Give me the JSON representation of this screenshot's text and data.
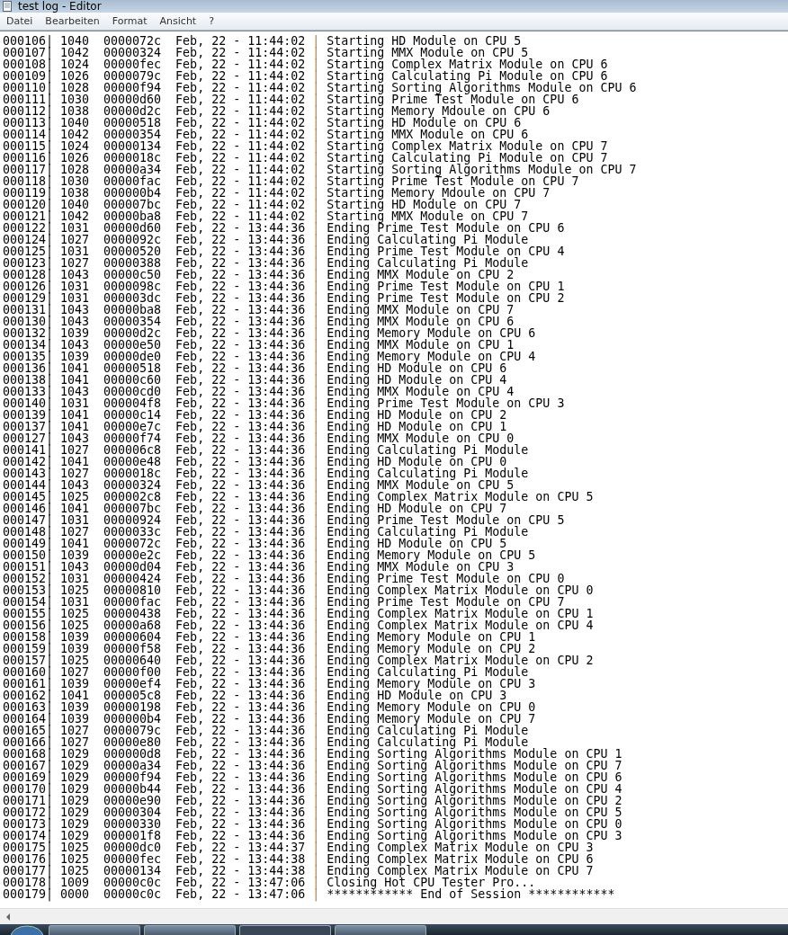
{
  "window": {
    "title": "test log - Editor"
  },
  "menu": [
    "Datei",
    "Bearbeiten",
    "Format",
    "Ansicht",
    "?"
  ],
  "rows": [
    {
      "no": "000106|",
      "tid": "1040",
      "addr": "0000072c",
      "time": "Feb, 22 - 11:44:02",
      "sep": "|",
      "msg": "Starting HD Module on CPU 5"
    },
    {
      "no": "000107|",
      "tid": "1042",
      "addr": "00000324",
      "time": "Feb, 22 - 11:44:02",
      "sep": "|",
      "msg": "Starting MMX Module on CPU 5"
    },
    {
      "no": "000108|",
      "tid": "1024",
      "addr": "00000fec",
      "time": "Feb, 22 - 11:44:02",
      "sep": "|",
      "msg": "Starting Complex Matrix Module on CPU 6"
    },
    {
      "no": "000109|",
      "tid": "1026",
      "addr": "0000079c",
      "time": "Feb, 22 - 11:44:02",
      "sep": "|",
      "msg": "Starting Calculating Pi Module on CPU 6"
    },
    {
      "no": "000110|",
      "tid": "1028",
      "addr": "00000f94",
      "time": "Feb, 22 - 11:44:02",
      "sep": "|",
      "msg": "Starting Sorting Algorithms Module on CPU 6"
    },
    {
      "no": "000111|",
      "tid": "1030",
      "addr": "00000d60",
      "time": "Feb, 22 - 11:44:02",
      "sep": "|",
      "msg": "Starting Prime Test Module on CPU 6"
    },
    {
      "no": "000112|",
      "tid": "1038",
      "addr": "00000d2c",
      "time": "Feb, 22 - 11:44:02",
      "sep": "|",
      "msg": "Starting Memory Mdoule on CPU 6"
    },
    {
      "no": "000113|",
      "tid": "1040",
      "addr": "00000518",
      "time": "Feb, 22 - 11:44:02",
      "sep": "|",
      "msg": "Starting HD Module on CPU 6"
    },
    {
      "no": "000114|",
      "tid": "1042",
      "addr": "00000354",
      "time": "Feb, 22 - 11:44:02",
      "sep": "|",
      "msg": "Starting MMX Module on CPU 6"
    },
    {
      "no": "000115|",
      "tid": "1024",
      "addr": "00000134",
      "time": "Feb, 22 - 11:44:02",
      "sep": "|",
      "msg": "Starting Complex Matrix Module on CPU 7"
    },
    {
      "no": "000116|",
      "tid": "1026",
      "addr": "0000018c",
      "time": "Feb, 22 - 11:44:02",
      "sep": "|",
      "msg": "Starting Calculating Pi Module on CPU 7"
    },
    {
      "no": "000117|",
      "tid": "1028",
      "addr": "00000a34",
      "time": "Feb, 22 - 11:44:02",
      "sep": "|",
      "msg": "Starting Sorting Algorithms Module on CPU 7"
    },
    {
      "no": "000118|",
      "tid": "1030",
      "addr": "00000fac",
      "time": "Feb, 22 - 11:44:02",
      "sep": "|",
      "msg": "Starting Prime Test Module on CPU 7"
    },
    {
      "no": "000119|",
      "tid": "1038",
      "addr": "000000b4",
      "time": "Feb, 22 - 11:44:02",
      "sep": "|",
      "msg": "Starting Memory Mdoule on CPU 7"
    },
    {
      "no": "000120|",
      "tid": "1040",
      "addr": "000007bc",
      "time": "Feb, 22 - 11:44:02",
      "sep": "|",
      "msg": "Starting HD Module on CPU 7"
    },
    {
      "no": "000121|",
      "tid": "1042",
      "addr": "00000ba8",
      "time": "Feb, 22 - 11:44:02",
      "sep": "|",
      "msg": "Starting MMX Module on CPU 7"
    },
    {
      "no": "000122|",
      "tid": "1031",
      "addr": "00000d60",
      "time": "Feb, 22 - 13:44:36",
      "sep": "|",
      "msg": "Ending Prime Test Module on CPU 6"
    },
    {
      "no": "000124|",
      "tid": "1027",
      "addr": "0000092c",
      "time": "Feb, 22 - 13:44:36",
      "sep": "|",
      "msg": "Ending Calculating Pi Module"
    },
    {
      "no": "000125|",
      "tid": "1031",
      "addr": "00000520",
      "time": "Feb, 22 - 13:44:36",
      "sep": "|",
      "msg": "Ending Prime Test Module on CPU 4"
    },
    {
      "no": "000123|",
      "tid": "1027",
      "addr": "00000388",
      "time": "Feb, 22 - 13:44:36",
      "sep": "|",
      "msg": "Ending Calculating Pi Module"
    },
    {
      "no": "000128|",
      "tid": "1043",
      "addr": "00000c50",
      "time": "Feb, 22 - 13:44:36",
      "sep": "|",
      "msg": "Ending MMX Module on CPU 2"
    },
    {
      "no": "000126|",
      "tid": "1031",
      "addr": "0000098c",
      "time": "Feb, 22 - 13:44:36",
      "sep": "|",
      "msg": "Ending Prime Test Module on CPU 1"
    },
    {
      "no": "000129|",
      "tid": "1031",
      "addr": "000003dc",
      "time": "Feb, 22 - 13:44:36",
      "sep": "|",
      "msg": "Ending Prime Test Module on CPU 2"
    },
    {
      "no": "000131|",
      "tid": "1043",
      "addr": "00000ba8",
      "time": "Feb, 22 - 13:44:36",
      "sep": "|",
      "msg": "Ending MMX Module on CPU 7"
    },
    {
      "no": "000130|",
      "tid": "1043",
      "addr": "00000354",
      "time": "Feb, 22 - 13:44:36",
      "sep": "|",
      "msg": "Ending MMX Module on CPU 6"
    },
    {
      "no": "000132|",
      "tid": "1039",
      "addr": "00000d2c",
      "time": "Feb, 22 - 13:44:36",
      "sep": "|",
      "msg": "Ending Memory Module on CPU 6"
    },
    {
      "no": "000134|",
      "tid": "1043",
      "addr": "00000e50",
      "time": "Feb, 22 - 13:44:36",
      "sep": "|",
      "msg": "Ending MMX Module on CPU 1"
    },
    {
      "no": "000135|",
      "tid": "1039",
      "addr": "00000de0",
      "time": "Feb, 22 - 13:44:36",
      "sep": "|",
      "msg": "Ending Memory Module on CPU 4"
    },
    {
      "no": "000136|",
      "tid": "1041",
      "addr": "00000518",
      "time": "Feb, 22 - 13:44:36",
      "sep": "|",
      "msg": "Ending HD Module on CPU 6"
    },
    {
      "no": "000138|",
      "tid": "1041",
      "addr": "00000c60",
      "time": "Feb, 22 - 13:44:36",
      "sep": "|",
      "msg": "Ending HD Module on CPU 4"
    },
    {
      "no": "000133|",
      "tid": "1043",
      "addr": "00000cd0",
      "time": "Feb, 22 - 13:44:36",
      "sep": "|",
      "msg": "Ending MMX Module on CPU 4"
    },
    {
      "no": "000140|",
      "tid": "1031",
      "addr": "000004f8",
      "time": "Feb, 22 - 13:44:36",
      "sep": "|",
      "msg": "Ending Prime Test Module on CPU 3"
    },
    {
      "no": "000139|",
      "tid": "1041",
      "addr": "00000c14",
      "time": "Feb, 22 - 13:44:36",
      "sep": "|",
      "msg": "Ending HD Module on CPU 2"
    },
    {
      "no": "000137|",
      "tid": "1041",
      "addr": "00000e7c",
      "time": "Feb, 22 - 13:44:36",
      "sep": "|",
      "msg": "Ending HD Module on CPU 1"
    },
    {
      "no": "000127|",
      "tid": "1043",
      "addr": "00000f74",
      "time": "Feb, 22 - 13:44:36",
      "sep": "|",
      "msg": "Ending MMX Module on CPU 0"
    },
    {
      "no": "000141|",
      "tid": "1027",
      "addr": "000006c8",
      "time": "Feb, 22 - 13:44:36",
      "sep": "|",
      "msg": "Ending Calculating Pi Module"
    },
    {
      "no": "000142|",
      "tid": "1041",
      "addr": "00000e48",
      "time": "Feb, 22 - 13:44:36",
      "sep": "|",
      "msg": "Ending HD Module on CPU 0"
    },
    {
      "no": "000143|",
      "tid": "1027",
      "addr": "0000018c",
      "time": "Feb, 22 - 13:44:36",
      "sep": "|",
      "msg": "Ending Calculating Pi Module"
    },
    {
      "no": "000144|",
      "tid": "1043",
      "addr": "00000324",
      "time": "Feb, 22 - 13:44:36",
      "sep": "|",
      "msg": "Ending MMX Module on CPU 5"
    },
    {
      "no": "000145|",
      "tid": "1025",
      "addr": "000002c8",
      "time": "Feb, 22 - 13:44:36",
      "sep": "|",
      "msg": "Ending Complex Matrix Module on CPU 5"
    },
    {
      "no": "000146|",
      "tid": "1041",
      "addr": "000007bc",
      "time": "Feb, 22 - 13:44:36",
      "sep": "|",
      "msg": "Ending HD Module on CPU 7"
    },
    {
      "no": "000147|",
      "tid": "1031",
      "addr": "00000924",
      "time": "Feb, 22 - 13:44:36",
      "sep": "|",
      "msg": "Ending Prime Test Module on CPU 5"
    },
    {
      "no": "000148|",
      "tid": "1027",
      "addr": "0000033c",
      "time": "Feb, 22 - 13:44:36",
      "sep": "|",
      "msg": "Ending Calculating Pi Module"
    },
    {
      "no": "000149|",
      "tid": "1041",
      "addr": "0000072c",
      "time": "Feb, 22 - 13:44:36",
      "sep": "|",
      "msg": "Ending HD Module on CPU 5"
    },
    {
      "no": "000150|",
      "tid": "1039",
      "addr": "00000e2c",
      "time": "Feb, 22 - 13:44:36",
      "sep": "|",
      "msg": "Ending Memory Module on CPU 5"
    },
    {
      "no": "000151|",
      "tid": "1043",
      "addr": "00000d04",
      "time": "Feb, 22 - 13:44:36",
      "sep": "|",
      "msg": "Ending MMX Module on CPU 3"
    },
    {
      "no": "000152|",
      "tid": "1031",
      "addr": "00000424",
      "time": "Feb, 22 - 13:44:36",
      "sep": "|",
      "msg": "Ending Prime Test Module on CPU 0"
    },
    {
      "no": "000153|",
      "tid": "1025",
      "addr": "00000810",
      "time": "Feb, 22 - 13:44:36",
      "sep": "|",
      "msg": "Ending Complex Matrix Module on CPU 0"
    },
    {
      "no": "000154|",
      "tid": "1031",
      "addr": "00000fac",
      "time": "Feb, 22 - 13:44:36",
      "sep": "|",
      "msg": "Ending Prime Test Module on CPU 7"
    },
    {
      "no": "000155|",
      "tid": "1025",
      "addr": "00000438",
      "time": "Feb, 22 - 13:44:36",
      "sep": "|",
      "msg": "Ending Complex Matrix Module on CPU 1"
    },
    {
      "no": "000156|",
      "tid": "1025",
      "addr": "00000a68",
      "time": "Feb, 22 - 13:44:36",
      "sep": "|",
      "msg": "Ending Complex Matrix Module on CPU 4"
    },
    {
      "no": "000158|",
      "tid": "1039",
      "addr": "00000604",
      "time": "Feb, 22 - 13:44:36",
      "sep": "|",
      "msg": "Ending Memory Module on CPU 1"
    },
    {
      "no": "000159|",
      "tid": "1039",
      "addr": "00000f58",
      "time": "Feb, 22 - 13:44:36",
      "sep": "|",
      "msg": "Ending Memory Module on CPU 2"
    },
    {
      "no": "000157|",
      "tid": "1025",
      "addr": "00000640",
      "time": "Feb, 22 - 13:44:36",
      "sep": "|",
      "msg": "Ending Complex Matrix Module on CPU 2"
    },
    {
      "no": "000160|",
      "tid": "1027",
      "addr": "00000f00",
      "time": "Feb, 22 - 13:44:36",
      "sep": "|",
      "msg": "Ending Calculating Pi Module"
    },
    {
      "no": "000161|",
      "tid": "1039",
      "addr": "00000ef4",
      "time": "Feb, 22 - 13:44:36",
      "sep": "|",
      "msg": "Ending Memory Module on CPU 3"
    },
    {
      "no": "000162|",
      "tid": "1041",
      "addr": "000005c8",
      "time": "Feb, 22 - 13:44:36",
      "sep": "|",
      "msg": "Ending HD Module on CPU 3"
    },
    {
      "no": "000163|",
      "tid": "1039",
      "addr": "00000198",
      "time": "Feb, 22 - 13:44:36",
      "sep": "|",
      "msg": "Ending Memory Module on CPU 0"
    },
    {
      "no": "000164|",
      "tid": "1039",
      "addr": "000000b4",
      "time": "Feb, 22 - 13:44:36",
      "sep": "|",
      "msg": "Ending Memory Module on CPU 7"
    },
    {
      "no": "000165|",
      "tid": "1027",
      "addr": "0000079c",
      "time": "Feb, 22 - 13:44:36",
      "sep": "|",
      "msg": "Ending Calculating Pi Module"
    },
    {
      "no": "000166|",
      "tid": "1027",
      "addr": "00000e80",
      "time": "Feb, 22 - 13:44:36",
      "sep": "|",
      "msg": "Ending Calculating Pi Module"
    },
    {
      "no": "000168|",
      "tid": "1029",
      "addr": "000000d8",
      "time": "Feb, 22 - 13:44:36",
      "sep": "|",
      "msg": "Ending Sorting Algorithms Module on CPU 1"
    },
    {
      "no": "000167|",
      "tid": "1029",
      "addr": "00000a34",
      "time": "Feb, 22 - 13:44:36",
      "sep": "|",
      "msg": "Ending Sorting Algorithms Module on CPU 7"
    },
    {
      "no": "000169|",
      "tid": "1029",
      "addr": "00000f94",
      "time": "Feb, 22 - 13:44:36",
      "sep": "|",
      "msg": "Ending Sorting Algorithms Module on CPU 6"
    },
    {
      "no": "000170|",
      "tid": "1029",
      "addr": "00000b44",
      "time": "Feb, 22 - 13:44:36",
      "sep": "|",
      "msg": "Ending Sorting Algorithms Module on CPU 4"
    },
    {
      "no": "000171|",
      "tid": "1029",
      "addr": "00000e90",
      "time": "Feb, 22 - 13:44:36",
      "sep": "|",
      "msg": "Ending Sorting Algorithms Module on CPU 2"
    },
    {
      "no": "000172|",
      "tid": "1029",
      "addr": "00000304",
      "time": "Feb, 22 - 13:44:36",
      "sep": "|",
      "msg": "Ending Sorting Algorithms Module on CPU 5"
    },
    {
      "no": "000173|",
      "tid": "1029",
      "addr": "00000330",
      "time": "Feb, 22 - 13:44:36",
      "sep": "|",
      "msg": "Ending Sorting Algorithms Module on CPU 0"
    },
    {
      "no": "000174|",
      "tid": "1029",
      "addr": "000001f8",
      "time": "Feb, 22 - 13:44:36",
      "sep": "|",
      "msg": "Ending Sorting Algorithms Module on CPU 3"
    },
    {
      "no": "000175|",
      "tid": "1025",
      "addr": "00000dc0",
      "time": "Feb, 22 - 13:44:37",
      "sep": "|",
      "msg": "Ending Complex Matrix Module on CPU 3"
    },
    {
      "no": "000176|",
      "tid": "1025",
      "addr": "00000fec",
      "time": "Feb, 22 - 13:44:38",
      "sep": "|",
      "msg": "Ending Complex Matrix Module on CPU 6"
    },
    {
      "no": "000177|",
      "tid": "1025",
      "addr": "00000134",
      "time": "Feb, 22 - 13:44:38",
      "sep": "|",
      "msg": "Ending Complex Matrix Module on CPU 7"
    },
    {
      "no": "000178|",
      "tid": "1009",
      "addr": "00000c0c",
      "time": "Feb, 22 - 13:47:06",
      "sep": "|",
      "msg": "Closing Hot CPU Tester Pro..."
    },
    {
      "no": "000179|",
      "tid": "0000",
      "addr": "00000c0c",
      "time": "Feb, 22 - 13:47:06",
      "sep": "|",
      "msg": "************ End of Session ************"
    }
  ]
}
